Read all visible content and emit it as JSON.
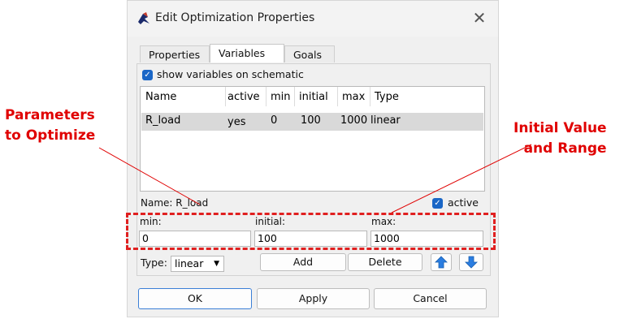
{
  "dialog": {
    "title": "Edit Optimization Properties",
    "close_glyph": "✕",
    "icon": "app-logo-icon"
  },
  "tabs": [
    {
      "label": "Properties",
      "active": false
    },
    {
      "label": "Variables",
      "active": true
    },
    {
      "label": "Goals",
      "active": false
    }
  ],
  "show_variables": {
    "label": "show variables on schematic",
    "checked": true
  },
  "table": {
    "headers": [
      "Name",
      "active",
      "min",
      "initial",
      "max",
      "Type"
    ],
    "rows": [
      {
        "name": "R_load",
        "active": "yes",
        "min": "0",
        "initial": "100",
        "max": "1000",
        "type": "linear"
      }
    ]
  },
  "selected": {
    "name_label": "Name: R_load",
    "active_label": "active",
    "active_checked": true
  },
  "range": {
    "min_label": "min:",
    "min_value": "0",
    "initial_label": "initial:",
    "initial_value": "100",
    "max_label": "max:",
    "max_value": "1000"
  },
  "controls": {
    "type_label": "Type:",
    "type_value": "linear",
    "add_label": "Add",
    "delete_label": "Delete",
    "up_icon": "up-arrow-icon",
    "down_icon": "down-arrow-icon"
  },
  "footer": {
    "ok": "OK",
    "apply": "Apply",
    "cancel": "Cancel"
  },
  "annotations": {
    "left_line1": "Parameters",
    "left_line2": "to Optimize",
    "right_line1": "Initial Value",
    "right_line2": "and Range"
  },
  "colors": {
    "accent": "#1a66c6",
    "annotation": "#e00000",
    "selection": "#d9d9d9"
  }
}
